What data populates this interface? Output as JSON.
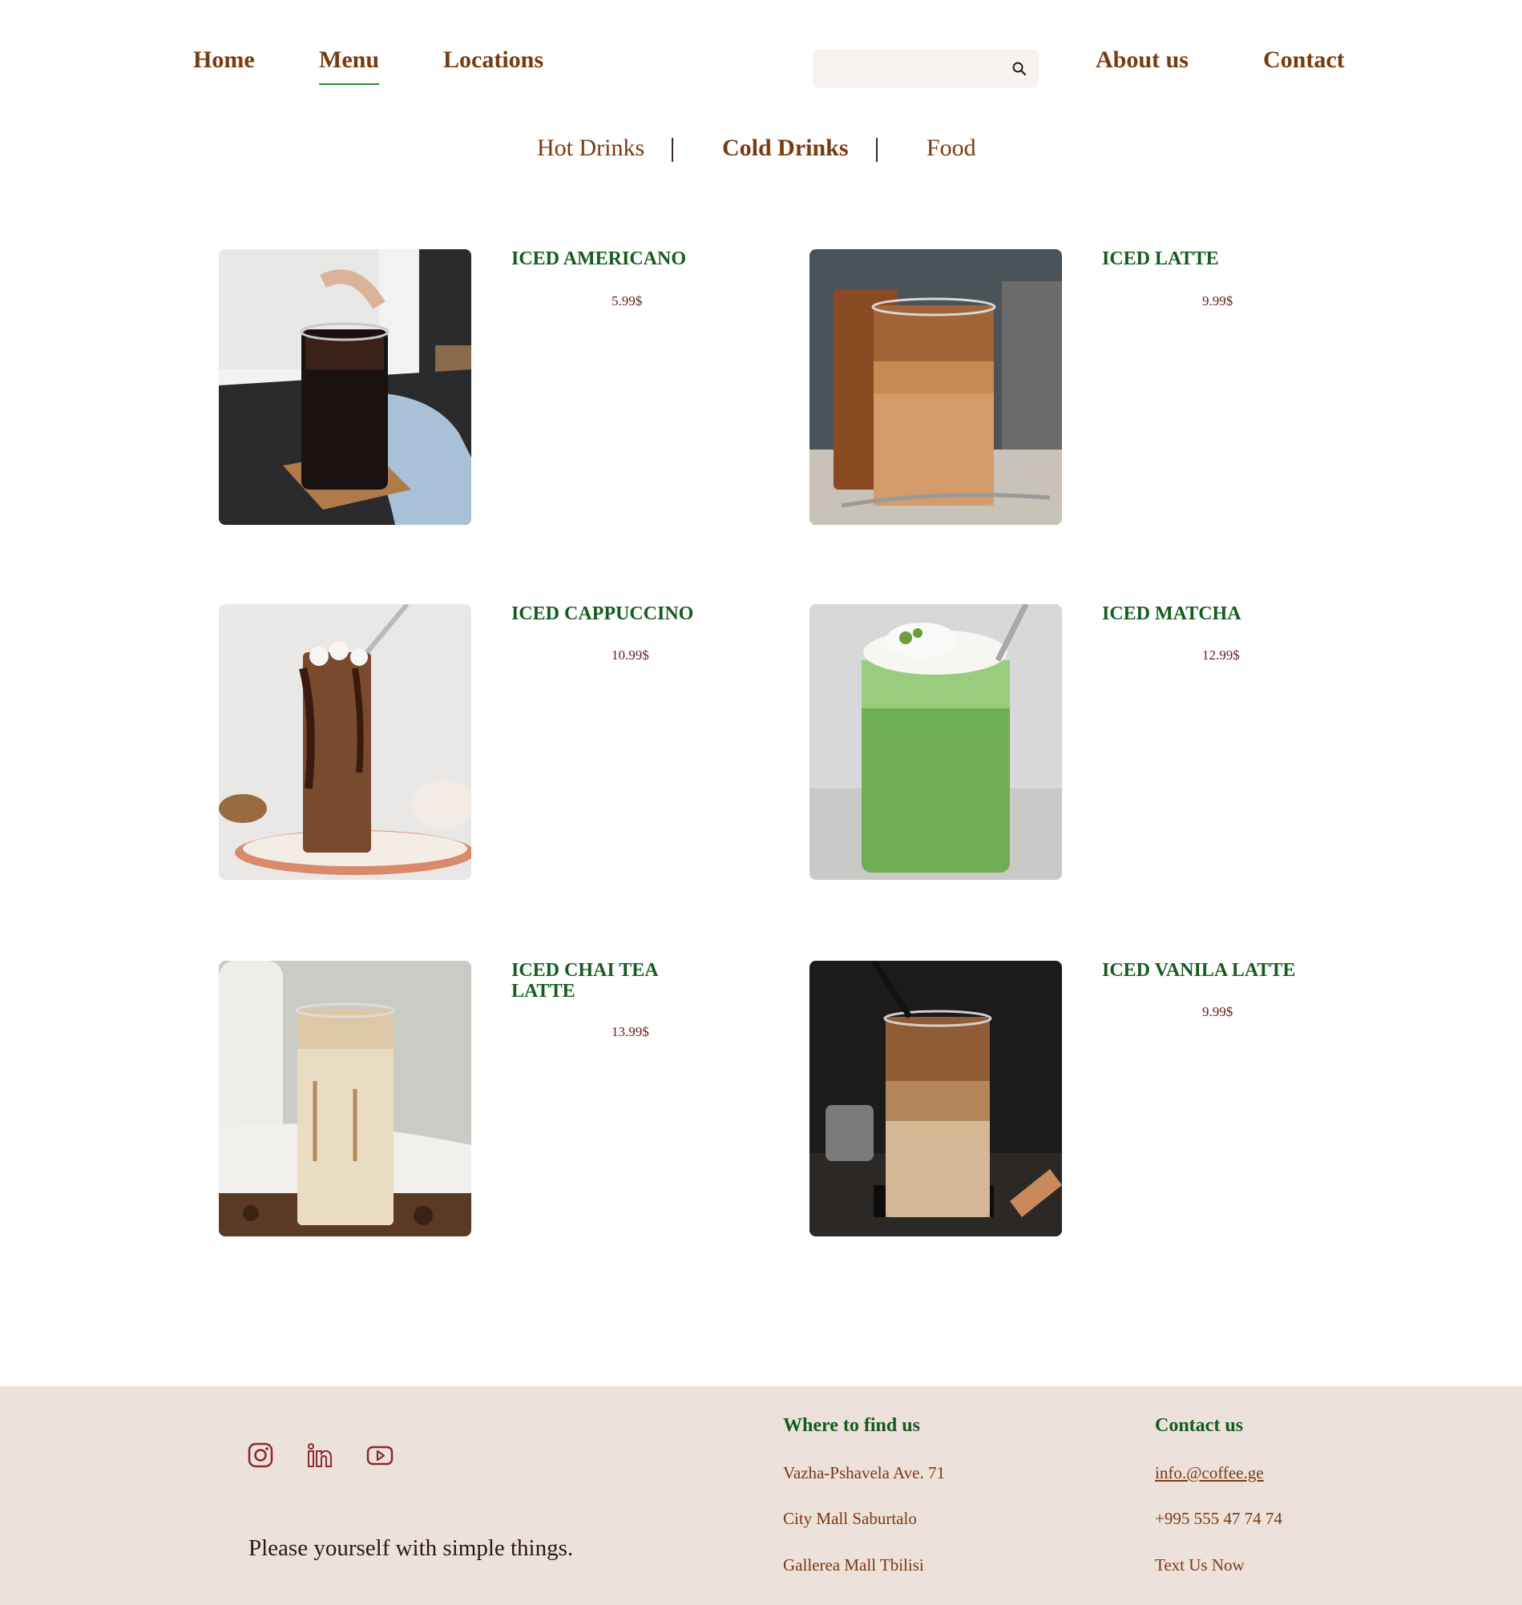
{
  "nav": {
    "home": "Home",
    "menu": "Menu",
    "locations": "Locations",
    "search_placeholder": "",
    "about": "About us",
    "contact": "Contact"
  },
  "tabs": {
    "hot": "Hot Drinks",
    "cold": "Cold Drinks",
    "food": "Food",
    "active": "Cold Drinks"
  },
  "products": [
    {
      "name": "ICED AMERICANO",
      "price": "5.99$"
    },
    {
      "name": "ICED LATTE",
      "price": "9.99$"
    },
    {
      "name": "ICED CAPPUCCINO",
      "price": "10.99$"
    },
    {
      "name": "ICED MATCHA",
      "price": "12.99$"
    },
    {
      "name": "ICED CHAI TEA LATTE",
      "price": "13.99$"
    },
    {
      "name": "ICED VANILA LATTE",
      "price": "9.99$"
    }
  ],
  "footer": {
    "social": [
      "instagram-icon",
      "linkedin-icon",
      "youtube-icon"
    ],
    "tagline": "Please yourself with simple things.",
    "where_heading": "Where to find us",
    "locations": [
      "Vazha-Pshavela Ave. 71",
      "City Mall Saburtalo",
      "Gallerea Mall Tbilisi"
    ],
    "contact_heading": "Contact us",
    "email": "info.@coffee.ge",
    "phone": "+995 555 47 74 74",
    "text_us": "Text Us Now"
  },
  "colors": {
    "brown": "#7a3a10",
    "green": "#145c1e",
    "price": "#6a1a1a",
    "footer_bg": "#ede1dc"
  }
}
